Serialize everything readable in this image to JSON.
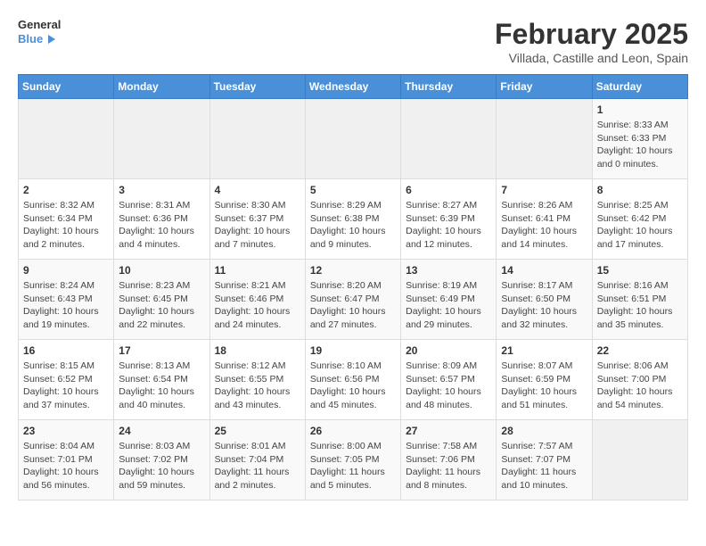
{
  "header": {
    "logo_general": "General",
    "logo_blue": "Blue",
    "month_year": "February 2025",
    "location": "Villada, Castille and Leon, Spain"
  },
  "weekdays": [
    "Sunday",
    "Monday",
    "Tuesday",
    "Wednesday",
    "Thursday",
    "Friday",
    "Saturday"
  ],
  "weeks": [
    [
      {
        "day": "",
        "info": ""
      },
      {
        "day": "",
        "info": ""
      },
      {
        "day": "",
        "info": ""
      },
      {
        "day": "",
        "info": ""
      },
      {
        "day": "",
        "info": ""
      },
      {
        "day": "",
        "info": ""
      },
      {
        "day": "1",
        "info": "Sunrise: 8:33 AM\nSunset: 6:33 PM\nDaylight: 10 hours and 0 minutes."
      }
    ],
    [
      {
        "day": "2",
        "info": "Sunrise: 8:32 AM\nSunset: 6:34 PM\nDaylight: 10 hours and 2 minutes."
      },
      {
        "day": "3",
        "info": "Sunrise: 8:31 AM\nSunset: 6:36 PM\nDaylight: 10 hours and 4 minutes."
      },
      {
        "day": "4",
        "info": "Sunrise: 8:30 AM\nSunset: 6:37 PM\nDaylight: 10 hours and 7 minutes."
      },
      {
        "day": "5",
        "info": "Sunrise: 8:29 AM\nSunset: 6:38 PM\nDaylight: 10 hours and 9 minutes."
      },
      {
        "day": "6",
        "info": "Sunrise: 8:27 AM\nSunset: 6:39 PM\nDaylight: 10 hours and 12 minutes."
      },
      {
        "day": "7",
        "info": "Sunrise: 8:26 AM\nSunset: 6:41 PM\nDaylight: 10 hours and 14 minutes."
      },
      {
        "day": "8",
        "info": "Sunrise: 8:25 AM\nSunset: 6:42 PM\nDaylight: 10 hours and 17 minutes."
      }
    ],
    [
      {
        "day": "9",
        "info": "Sunrise: 8:24 AM\nSunset: 6:43 PM\nDaylight: 10 hours and 19 minutes."
      },
      {
        "day": "10",
        "info": "Sunrise: 8:23 AM\nSunset: 6:45 PM\nDaylight: 10 hours and 22 minutes."
      },
      {
        "day": "11",
        "info": "Sunrise: 8:21 AM\nSunset: 6:46 PM\nDaylight: 10 hours and 24 minutes."
      },
      {
        "day": "12",
        "info": "Sunrise: 8:20 AM\nSunset: 6:47 PM\nDaylight: 10 hours and 27 minutes."
      },
      {
        "day": "13",
        "info": "Sunrise: 8:19 AM\nSunset: 6:49 PM\nDaylight: 10 hours and 29 minutes."
      },
      {
        "day": "14",
        "info": "Sunrise: 8:17 AM\nSunset: 6:50 PM\nDaylight: 10 hours and 32 minutes."
      },
      {
        "day": "15",
        "info": "Sunrise: 8:16 AM\nSunset: 6:51 PM\nDaylight: 10 hours and 35 minutes."
      }
    ],
    [
      {
        "day": "16",
        "info": "Sunrise: 8:15 AM\nSunset: 6:52 PM\nDaylight: 10 hours and 37 minutes."
      },
      {
        "day": "17",
        "info": "Sunrise: 8:13 AM\nSunset: 6:54 PM\nDaylight: 10 hours and 40 minutes."
      },
      {
        "day": "18",
        "info": "Sunrise: 8:12 AM\nSunset: 6:55 PM\nDaylight: 10 hours and 43 minutes."
      },
      {
        "day": "19",
        "info": "Sunrise: 8:10 AM\nSunset: 6:56 PM\nDaylight: 10 hours and 45 minutes."
      },
      {
        "day": "20",
        "info": "Sunrise: 8:09 AM\nSunset: 6:57 PM\nDaylight: 10 hours and 48 minutes."
      },
      {
        "day": "21",
        "info": "Sunrise: 8:07 AM\nSunset: 6:59 PM\nDaylight: 10 hours and 51 minutes."
      },
      {
        "day": "22",
        "info": "Sunrise: 8:06 AM\nSunset: 7:00 PM\nDaylight: 10 hours and 54 minutes."
      }
    ],
    [
      {
        "day": "23",
        "info": "Sunrise: 8:04 AM\nSunset: 7:01 PM\nDaylight: 10 hours and 56 minutes."
      },
      {
        "day": "24",
        "info": "Sunrise: 8:03 AM\nSunset: 7:02 PM\nDaylight: 10 hours and 59 minutes."
      },
      {
        "day": "25",
        "info": "Sunrise: 8:01 AM\nSunset: 7:04 PM\nDaylight: 11 hours and 2 minutes."
      },
      {
        "day": "26",
        "info": "Sunrise: 8:00 AM\nSunset: 7:05 PM\nDaylight: 11 hours and 5 minutes."
      },
      {
        "day": "27",
        "info": "Sunrise: 7:58 AM\nSunset: 7:06 PM\nDaylight: 11 hours and 8 minutes."
      },
      {
        "day": "28",
        "info": "Sunrise: 7:57 AM\nSunset: 7:07 PM\nDaylight: 11 hours and 10 minutes."
      },
      {
        "day": "",
        "info": ""
      }
    ]
  ]
}
